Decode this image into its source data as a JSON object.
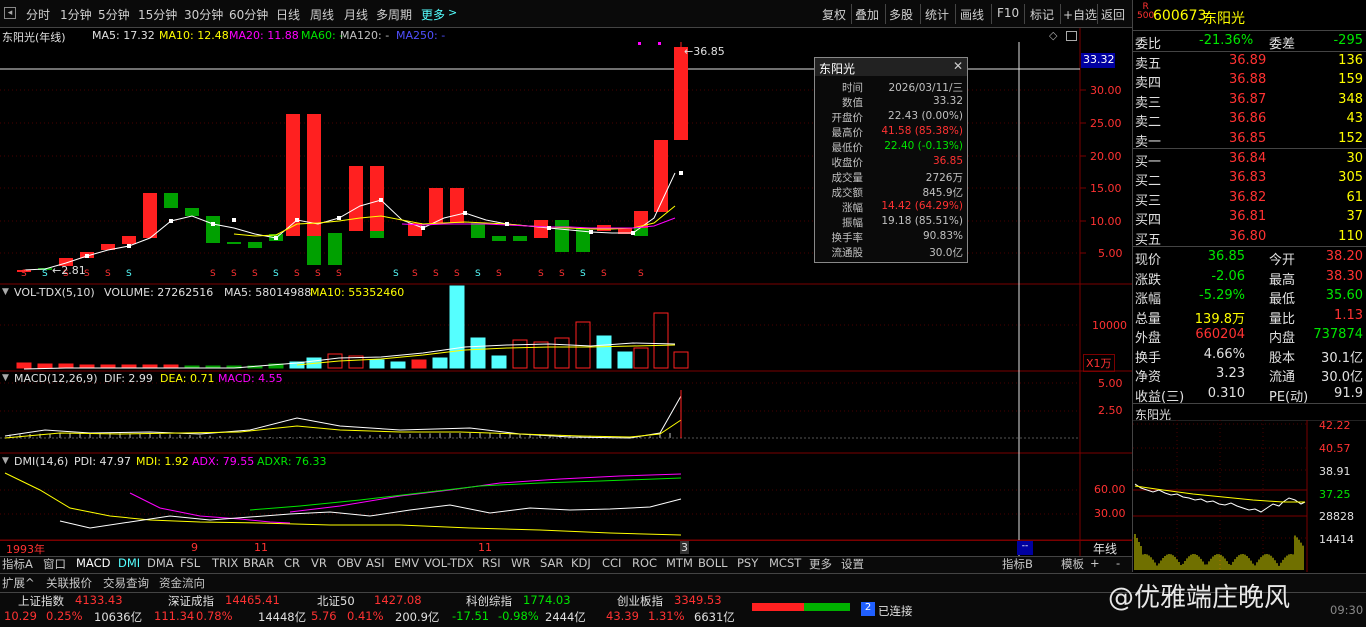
{
  "toolbar": {
    "timeframes": [
      "分时",
      "1分钟",
      "5分钟",
      "15分钟",
      "30分钟",
      "60分钟",
      "日线",
      "周线",
      "月线",
      "多周期",
      "更多"
    ],
    "right_buttons": [
      "复权",
      "叠加",
      "多股",
      "统计",
      "画线",
      "F10",
      "标记",
      "+自选",
      "返回"
    ]
  },
  "kline": {
    "name": "东阳光(年线)",
    "ma5": "MA5: 17.32",
    "ma10": "MA10: 12.48",
    "ma20": "MA20: 11.88",
    "ma60": "MA60: -",
    "ma120": "MA120: -",
    "ma250": "MA250: -",
    "high_label": "36.85",
    "low_label": "2.81",
    "price_tag": "33.32",
    "axis": [
      "30.00",
      "25.00",
      "20.00",
      "15.00",
      "10.00",
      "5.00"
    ],
    "colors": {
      "up": "#ff2020",
      "down": "#00a000"
    }
  },
  "popup": {
    "title": "东阳光",
    "rows": [
      {
        "k": "时间",
        "v": "2026/03/11/三",
        "c": "#c0c0c0"
      },
      {
        "k": "数值",
        "v": "33.32",
        "c": "#c0c0c0"
      },
      {
        "k": "开盘价",
        "v": "22.43 (0.00%)",
        "c": "#c0c0c0"
      },
      {
        "k": "最高价",
        "v": "41.58 (85.38%)",
        "c": "#ff3232"
      },
      {
        "k": "最低价",
        "v": "22.40 (-0.13%)",
        "c": "#00e600"
      },
      {
        "k": "收盘价",
        "v": "36.85",
        "c": "#ff3232"
      },
      {
        "k": "成交量",
        "v": "2726万",
        "c": "#c0c0c0"
      },
      {
        "k": "成交额",
        "v": "845.9亿",
        "c": "#c0c0c0"
      },
      {
        "k": "涨幅",
        "v": "14.42 (64.29%)",
        "c": "#ff3232"
      },
      {
        "k": "振幅",
        "v": "19.18 (85.51%)",
        "c": "#c0c0c0"
      },
      {
        "k": "换手率",
        "v": "90.83%",
        "c": "#c0c0c0"
      },
      {
        "k": "流通股",
        "v": "30.0亿",
        "c": "#c0c0c0"
      }
    ]
  },
  "vol": {
    "title": "VOL-TDX(5,10)",
    "volume": "VOLUME: 27262516",
    "ma5": "MA5: 58014988",
    "ma10": "MA10: 55352460",
    "axis_top": "10000",
    "unit": "X1万"
  },
  "macd": {
    "title": "MACD(12,26,9)",
    "dif": "DIF: 2.99",
    "dea": "DEA: 0.71",
    "macd": "MACD: 4.55",
    "axis": [
      "5.00",
      "2.50"
    ]
  },
  "dmi": {
    "title": "DMI(14,6)",
    "pdi": "PDI: 47.97",
    "mdi": "MDI: 1.92",
    "adx": "ADX: 79.55",
    "adxr": "ADXR: 76.33",
    "axis": [
      "60.00",
      "30.00"
    ]
  },
  "timeline": {
    "start": "1993年",
    "m1": "9",
    "m2": "11",
    "m3": "11",
    "m4": "3",
    "right": "年线"
  },
  "tabs": [
    "指标A",
    "窗口",
    "MACD",
    "DMI",
    "DMA",
    "FSL",
    "TRIX",
    "BRAR",
    "CR",
    "VR",
    "OBV",
    "ASI",
    "EMV",
    "VOL-TDX",
    "RSI",
    "WR",
    "SAR",
    "KDJ",
    "CCI",
    "ROC",
    "MTM",
    "BOLL",
    "PSY",
    "MCST",
    "更多",
    "设置"
  ],
  "tabs_right": [
    "指标B",
    "模板"
  ],
  "tabs2": [
    "扩展^",
    "关联报价",
    "交易查询",
    "资金流向"
  ],
  "quote": {
    "code": "600673",
    "name": "东阳光",
    "badge": "R",
    "badge2": "500",
    "weibi_label": "委比",
    "weibi": "-21.36%",
    "weicha_label": "委差",
    "weicha": "-295",
    "sells": [
      {
        "l": "卖五",
        "p": "36.89",
        "q": "136"
      },
      {
        "l": "卖四",
        "p": "36.88",
        "q": "159"
      },
      {
        "l": "卖三",
        "p": "36.87",
        "q": "348"
      },
      {
        "l": "卖二",
        "p": "36.86",
        "q": "43"
      },
      {
        "l": "卖一",
        "p": "36.85",
        "q": "152"
      }
    ],
    "buys": [
      {
        "l": "买一",
        "p": "36.84",
        "q": "30"
      },
      {
        "l": "买二",
        "p": "36.83",
        "q": "305"
      },
      {
        "l": "买三",
        "p": "36.82",
        "q": "61"
      },
      {
        "l": "买四",
        "p": "36.81",
        "q": "37"
      },
      {
        "l": "买五",
        "p": "36.80",
        "q": "110"
      }
    ],
    "stats": [
      {
        "a": "现价",
        "av": "36.85",
        "ac": "#00e600",
        "b": "今开",
        "bv": "38.20",
        "bc": "#ff3232"
      },
      {
        "a": "涨跌",
        "av": "-2.06",
        "ac": "#00e600",
        "b": "最高",
        "bv": "38.30",
        "bc": "#ff3232"
      },
      {
        "a": "涨幅",
        "av": "-5.29%",
        "ac": "#00e600",
        "b": "最低",
        "bv": "35.60",
        "bc": "#00e600"
      },
      {
        "a": "总量",
        "av": "139.8万",
        "ac": "#ffff00",
        "b": "量比",
        "bv": "1.13",
        "bc": "#ff3232"
      },
      {
        "a": "外盘",
        "av": "660204",
        "ac": "#ff3232",
        "b": "内盘",
        "bv": "737874",
        "bc": "#00e600"
      },
      {
        "a": "换手",
        "av": "4.66%",
        "ac": "#e0e0e0",
        "b": "股本",
        "bv": "30.1亿",
        "bc": "#e0e0e0"
      },
      {
        "a": "净资",
        "av": "3.23",
        "ac": "#e0e0e0",
        "b": "流通",
        "bv": "30.0亿",
        "bc": "#e0e0e0"
      },
      {
        "a": "收益(三)",
        "av": "0.310",
        "ac": "#e0e0e0",
        "b": "PE(动)",
        "bv": "91.9",
        "bc": "#e0e0e0"
      }
    ],
    "mini_title": "东阳光",
    "mini_axis": [
      "42.22",
      "40.57",
      "38.91",
      "37.25",
      "28828",
      "14414"
    ]
  },
  "status": {
    "indices": [
      {
        "name": "上证指数",
        "val": "4133.43",
        "c": "#ff3232"
      },
      {
        "name": "深证成指",
        "val": "14465.41",
        "c": "#ff3232"
      },
      {
        "name": "北证50",
        "val": "1427.08",
        "c": "#ff3232"
      },
      {
        "name": "科创综指",
        "val": "1774.03",
        "c": "#00e600"
      },
      {
        "name": "创业板指",
        "val": "3349.53",
        "c": "#ff3232"
      }
    ],
    "row2": [
      {
        "t": "10.29",
        "c": "#ff3232"
      },
      {
        "t": "0.25%",
        "c": "#ff3232"
      },
      {
        "t": "10636亿",
        "c": "#e0e0e0"
      },
      {
        "t": "111.34",
        "c": "#ff3232"
      },
      {
        "t": "0.78%",
        "c": "#ff3232"
      },
      {
        "t": "14448亿",
        "c": "#e0e0e0"
      },
      {
        "t": "5.76",
        "c": "#ff3232"
      },
      {
        "t": "0.41%",
        "c": "#ff3232"
      },
      {
        "t": "200.9亿",
        "c": "#e0e0e0"
      },
      {
        "t": "-17.51",
        "c": "#00e600"
      },
      {
        "t": "-0.98%",
        "c": "#00e600"
      },
      {
        "t": "2444亿",
        "c": "#e0e0e0"
      },
      {
        "t": "43.39",
        "c": "#ff3232"
      },
      {
        "t": "1.31%",
        "c": "#ff3232"
      },
      {
        "t": "6631亿",
        "c": "#e0e0e0"
      }
    ],
    "conn_num": "2",
    "conn_label": "已连接",
    "watermark": "@优雅端庄晚风",
    "time": "09:30"
  }
}
